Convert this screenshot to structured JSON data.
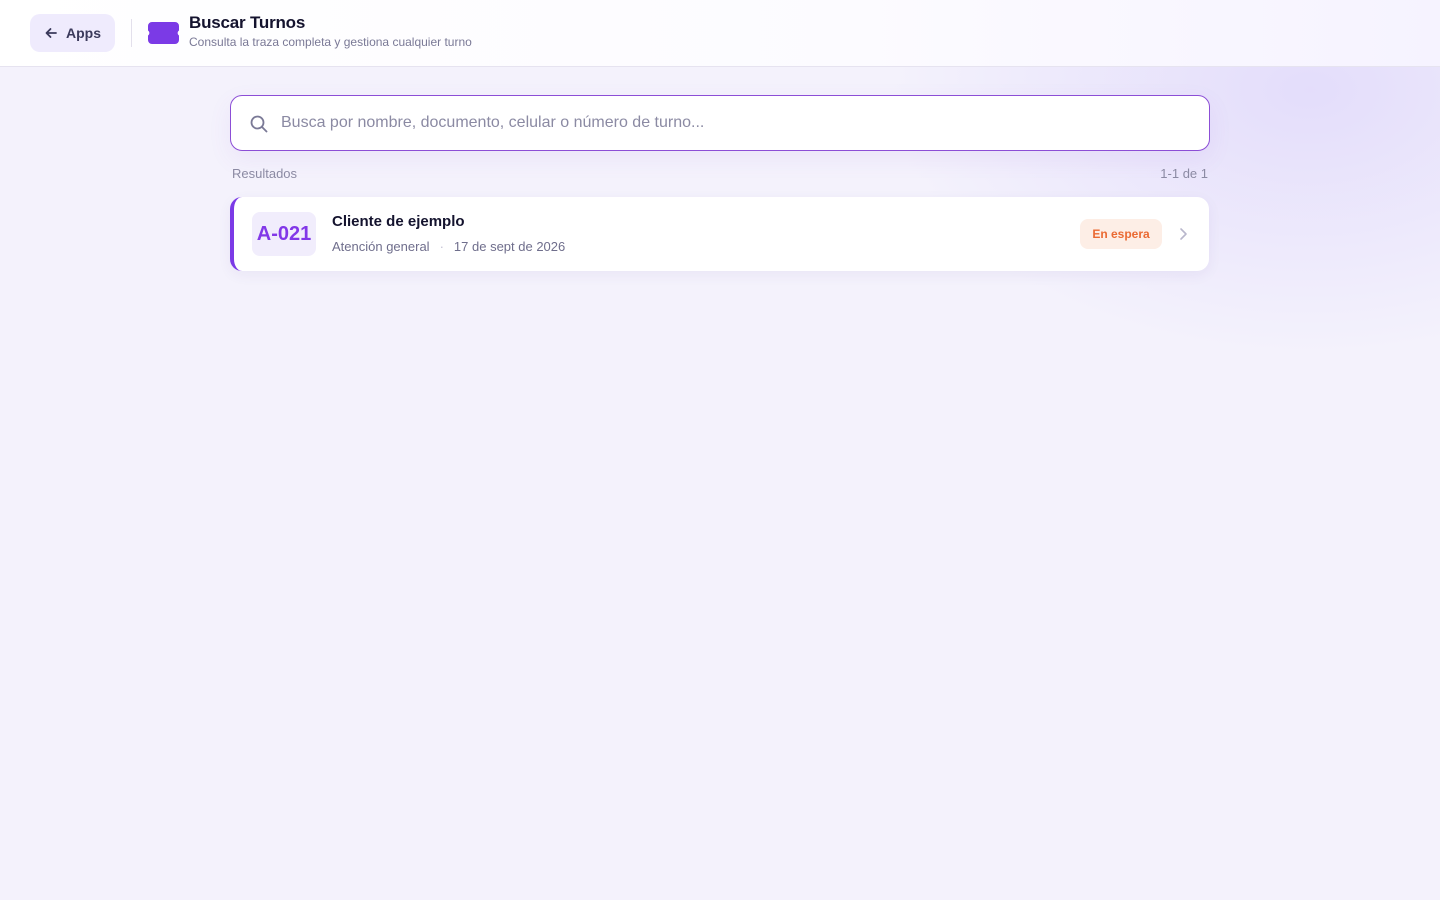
{
  "header": {
    "back_label": "Apps",
    "title": "Buscar Turnos",
    "subtitle": "Consulta la traza completa y gestiona cualquier turno"
  },
  "search": {
    "placeholder": "Busca por nombre, documento, celular o número de turno...",
    "value": ""
  },
  "results": {
    "label": "Resultados",
    "count": "1-1 de 1",
    "items": [
      {
        "ticket": "A-021",
        "client": "Cliente de ejemplo",
        "service": "Atención general",
        "separator": "·",
        "date": "17 de sept de 2026",
        "status": "En espera"
      }
    ]
  },
  "colors": {
    "accent": "#7b3ae6",
    "status_waiting_bg": "#fdeee6",
    "status_waiting_text": "#ea6a33"
  },
  "icons": {
    "back": "arrow-left-icon",
    "app": "ticket-icon",
    "search": "search-icon",
    "open": "chevron-right-icon"
  }
}
